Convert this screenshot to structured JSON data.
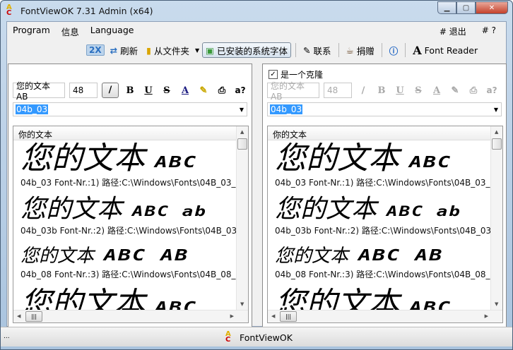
{
  "window": {
    "title": "FontViewOK 7.31 Admin (x64)",
    "status": "FontViewOK",
    "status_dots": "..."
  },
  "menu": {
    "items": [
      "Program",
      "信息",
      "Language"
    ],
    "right": [
      "# 退出",
      "# ?"
    ]
  },
  "toolbar": {
    "zoom": "2X",
    "refresh": "刷新",
    "from_folder": "从文件夹",
    "installed": "已安装的系统字体",
    "contact": "联系",
    "donate": "捐赠",
    "font_reader": "Font Reader"
  },
  "colors": {
    "selection": "#3399ff",
    "accent": "#2a6fc0"
  },
  "panels": [
    {
      "clone_label": null,
      "clone_checked": null,
      "sample_text": "您的文本 AB",
      "size": "48",
      "font": "04b_03",
      "list_header": "你的文本",
      "disabled": false,
      "items": [
        {
          "preview_zh": "您的文本",
          "preview_latin": "ABC",
          "caption": "04b_03 Font-Nr.:1) 路径:C:\\Windows\\Fonts\\04B_03_"
        },
        {
          "preview_zh": "您的文本",
          "preview_latin": "ABC ab",
          "caption": "04b_03b Font-Nr.:2) 路径:C:\\Windows\\Fonts\\04B_03"
        },
        {
          "preview_zh": "您的文本",
          "preview_latin": "ABC AB",
          "caption": "04b_08 Font-Nr.:3) 路径:C:\\Windows\\Fonts\\04B_08_"
        },
        {
          "preview_zh": "您的文本",
          "preview_latin": "ABC",
          "caption": ""
        }
      ]
    },
    {
      "clone_label": "是一个克隆",
      "clone_checked": true,
      "sample_text": "您的文本 AB",
      "size": "48",
      "font": "04b_03",
      "list_header": "你的文本",
      "disabled": true,
      "items": [
        {
          "preview_zh": "您的文本",
          "preview_latin": "ABC",
          "caption": "04b_03 Font-Nr.:1) 路径:C:\\Windows\\Fonts\\04B_03_"
        },
        {
          "preview_zh": "您的文本",
          "preview_latin": "ABC ab",
          "caption": "04b_03b Font-Nr.:2) 路径:C:\\Windows\\Fonts\\04B_03"
        },
        {
          "preview_zh": "您的文本",
          "preview_latin": "ABC AB",
          "caption": "04b_08 Font-Nr.:3) 路径:C:\\Windows\\Fonts\\04B_08_"
        },
        {
          "preview_zh": "您的文本",
          "preview_latin": "ABC",
          "caption": ""
        }
      ]
    }
  ]
}
